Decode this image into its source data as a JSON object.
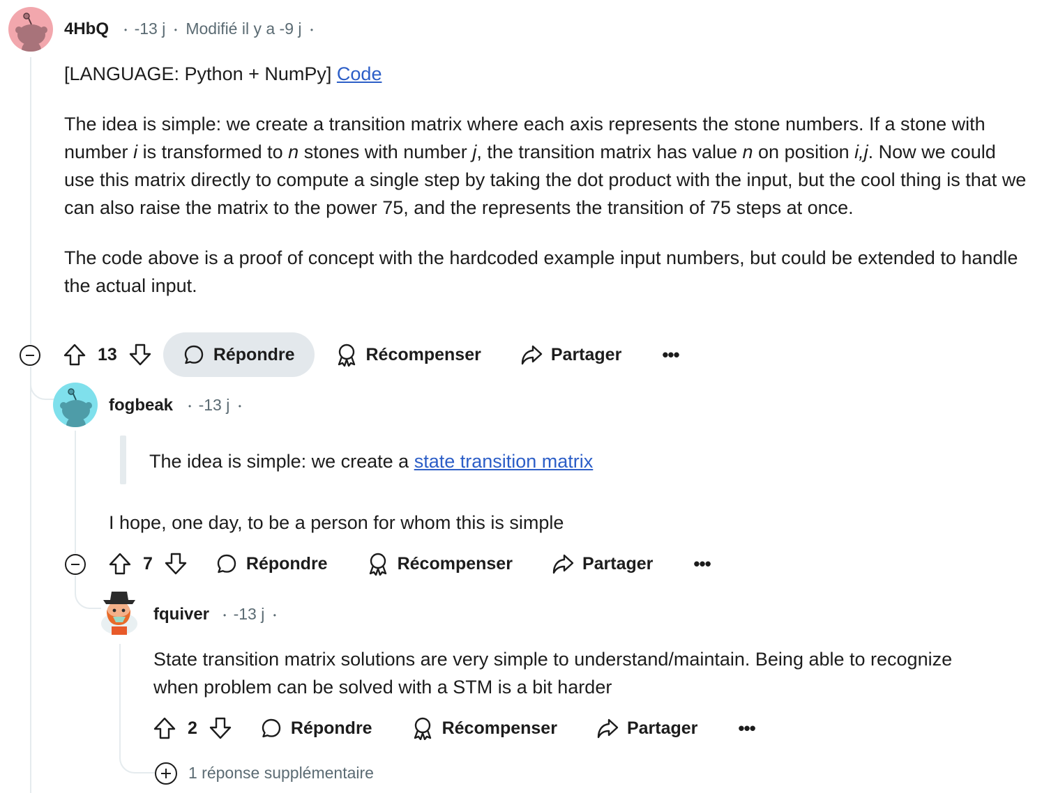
{
  "comments": [
    {
      "author": "4HbQ",
      "sep1": "•",
      "age": "-13 j",
      "sep2": "•",
      "edited": "Modifié il y a -9 j",
      "sep3": "•",
      "avatar_color": "#f2a7ad",
      "lang_prefix": "[LANGUAGE: Python + NumPy]",
      "code_link": "Code",
      "para1_a": "The idea is simple: we create a transition matrix where each axis represents the stone numbers. If a stone with number ",
      "para1_i": "i",
      "para1_b": " is transformed to ",
      "para1_n": "n",
      "para1_c": " stones with number ",
      "para1_j": "j",
      "para1_d": ", the transition matrix has value ",
      "para1_n2": "n",
      "para1_e": " on position ",
      "para1_ij": "i,j",
      "para1_f": ". Now we could use this matrix directly to compute a single step by taking the dot product with the input, but the cool thing is that we can also raise the matrix to the power 75, and the represents the transition of 75 steps at once.",
      "para2": "The code above is a proof of concept with the hardcoded example input numbers, but could be extended to handle the actual input.",
      "score": "13",
      "reply": "Répondre",
      "award": "Récompenser",
      "share": "Partager",
      "more": "•••"
    },
    {
      "author": "fogbeak",
      "sep1": "•",
      "age": "-13 j",
      "sep2": "•",
      "avatar_color": "#7fe0ec",
      "quote_prefix": "The idea is simple: we create a ",
      "quote_link": "state transition matrix",
      "text": "I hope, one day, to be a person for whom this is simple",
      "score": "7",
      "reply": "Répondre",
      "award": "Récompenser",
      "share": "Partager",
      "more": "•••"
    },
    {
      "author": "fquiver",
      "sep1": "•",
      "age": "-13 j",
      "sep2": "•",
      "text": "State transition matrix solutions are very simple to understand/maintain. Being able to recognize when problem can be solved with a STM is a bit harder",
      "score": "2",
      "reply": "Répondre",
      "award": "Récompenser",
      "share": "Partager",
      "more": "•••"
    }
  ],
  "more_replies": "1 réponse supplémentaire",
  "colors": {
    "link": "#2c5ec7",
    "meta": "#5b6b73",
    "thread": "#e5ebee",
    "pill": "#e3e8ec"
  }
}
